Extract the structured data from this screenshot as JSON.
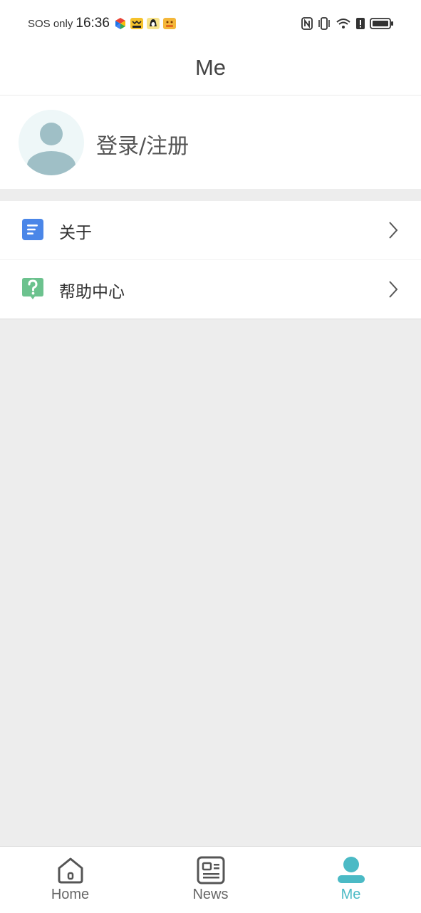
{
  "status_bar": {
    "carrier": "SOS only",
    "time": "16:36",
    "notification_icons": [
      "app-icon-colorful",
      "app-icon-yellow-face",
      "app-icon-penguin",
      "app-icon-yellow-character"
    ],
    "system_icons": [
      "nfc-icon",
      "vibrate-icon",
      "wifi-icon",
      "alert-icon",
      "battery-icon"
    ]
  },
  "header": {
    "title": "Me"
  },
  "profile": {
    "login_label": "登录/注册",
    "avatar_icon": "user-avatar-icon"
  },
  "menu": {
    "items": [
      {
        "label": "关于",
        "icon": "document-icon",
        "icon_color": "#4a86e8"
      },
      {
        "label": "帮助中心",
        "icon": "help-icon",
        "icon_color": "#6cc28e"
      }
    ]
  },
  "tabs": [
    {
      "label": "Home",
      "icon": "home-icon",
      "active": false
    },
    {
      "label": "News",
      "icon": "news-icon",
      "active": false
    },
    {
      "label": "Me",
      "icon": "person-icon",
      "active": true
    }
  ],
  "colors": {
    "accent": "#4bbac5",
    "background": "#ededed",
    "surface": "#ffffff",
    "avatar_fill": "#9fbfc6"
  }
}
